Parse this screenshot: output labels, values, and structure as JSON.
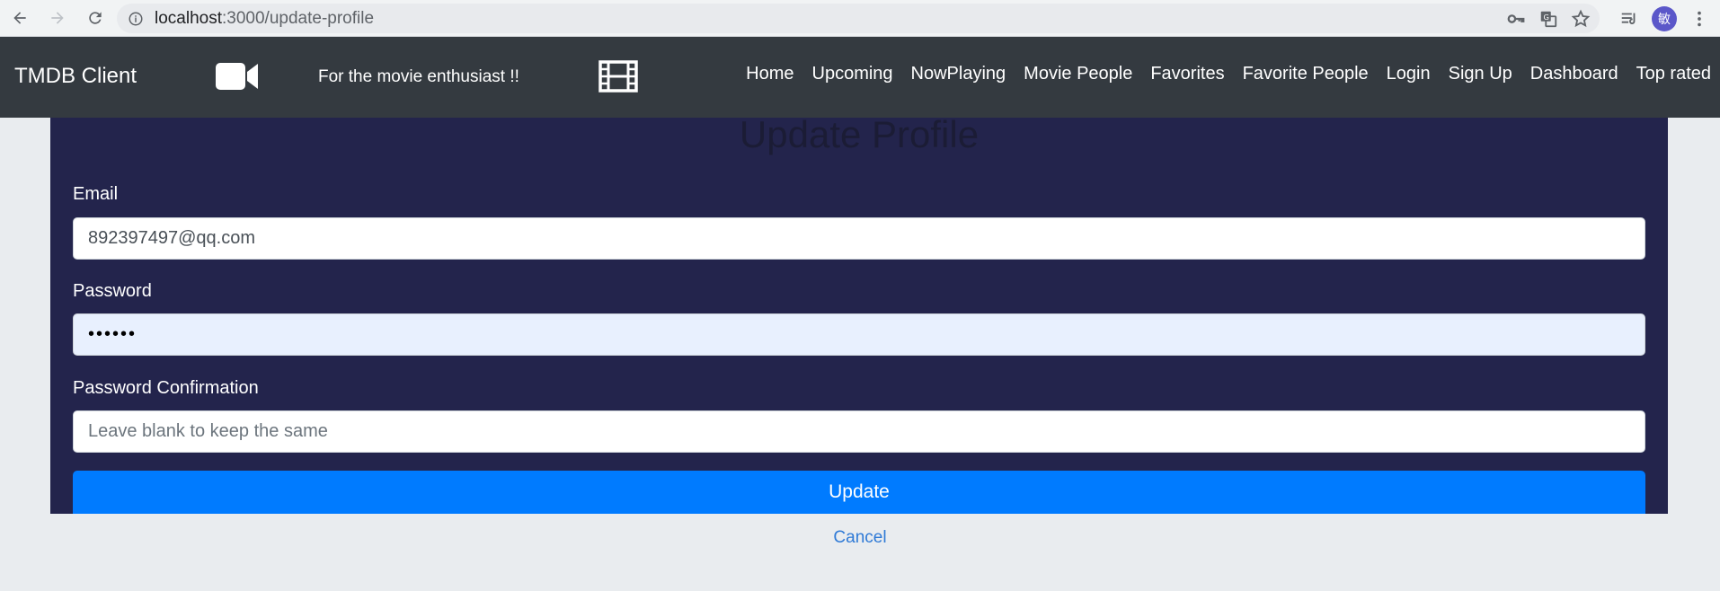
{
  "browser": {
    "url_host": "localhost",
    "url_path": ":3000/update-profile",
    "avatar_letter": "敏"
  },
  "navbar": {
    "brand": "TMDB Client",
    "tagline": "For the movie enthusiast !!",
    "links": [
      "Home",
      "Upcoming",
      "NowPlaying",
      "Movie People",
      "Favorites",
      "Favorite People",
      "Login",
      "Sign Up",
      "Dashboard",
      "Top rated"
    ]
  },
  "form": {
    "title": "Update Profile",
    "email_label": "Email",
    "email_value": "892397497@qq.com",
    "password_label": "Password",
    "password_value": "••••••",
    "confirm_label": "Password Confirmation",
    "confirm_placeholder": "Leave blank to keep the same",
    "update_label": "Update",
    "cancel_label": "Cancel"
  },
  "colors": {
    "navbar_bg": "#343a40",
    "panel_bg": "#23244c",
    "primary": "#007bff",
    "page_bg": "#e9ecef",
    "link": "#2f7ad6"
  }
}
